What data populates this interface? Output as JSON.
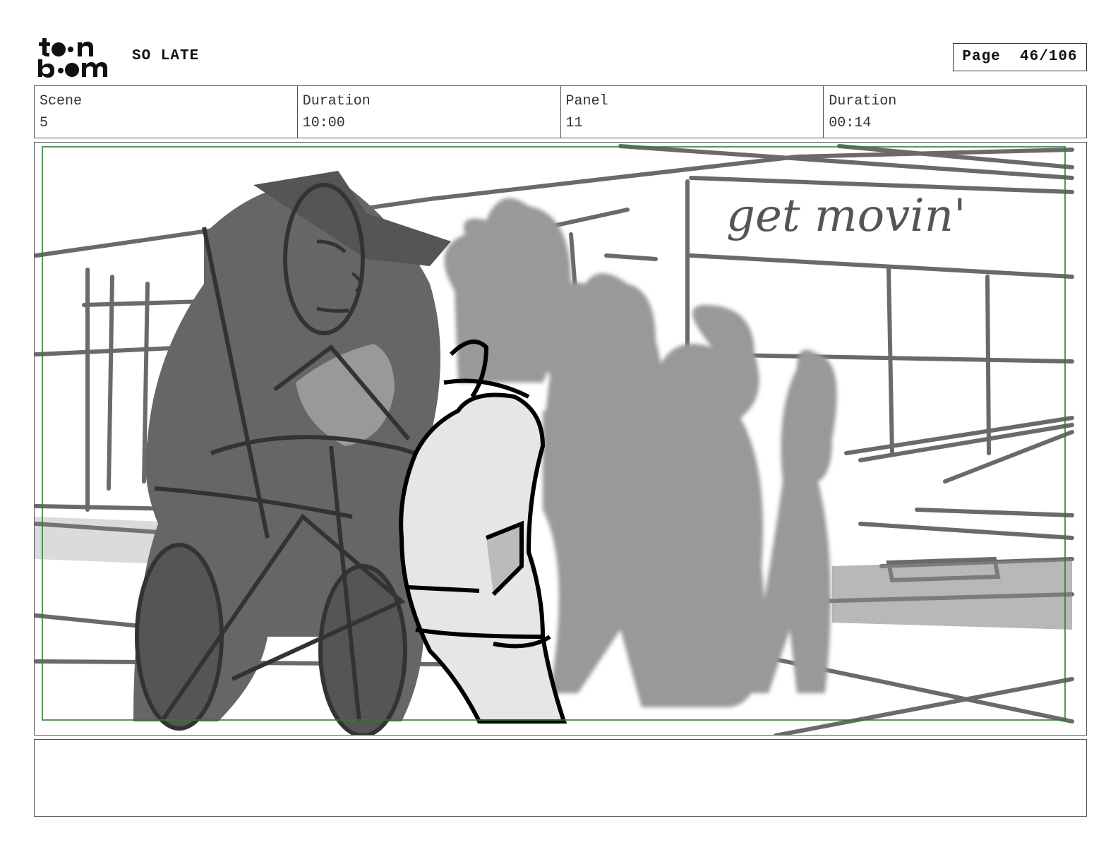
{
  "header": {
    "logo_text": "toonboom",
    "project_title": "SO LATE",
    "page_label": "Page",
    "page_number": "46/106"
  },
  "info": {
    "scene_label": "Scene",
    "scene_value": "5",
    "scene_duration_label": "Duration",
    "scene_duration_value": "10:00",
    "panel_label": "Panel",
    "panel_value": "11",
    "panel_duration_label": "Duration",
    "panel_duration_value": "00:14"
  },
  "panel": {
    "sign_text": "get movin'"
  },
  "caption": {
    "text": ""
  },
  "colors": {
    "safe_frame": "#2e7d32",
    "border": "#555555"
  }
}
